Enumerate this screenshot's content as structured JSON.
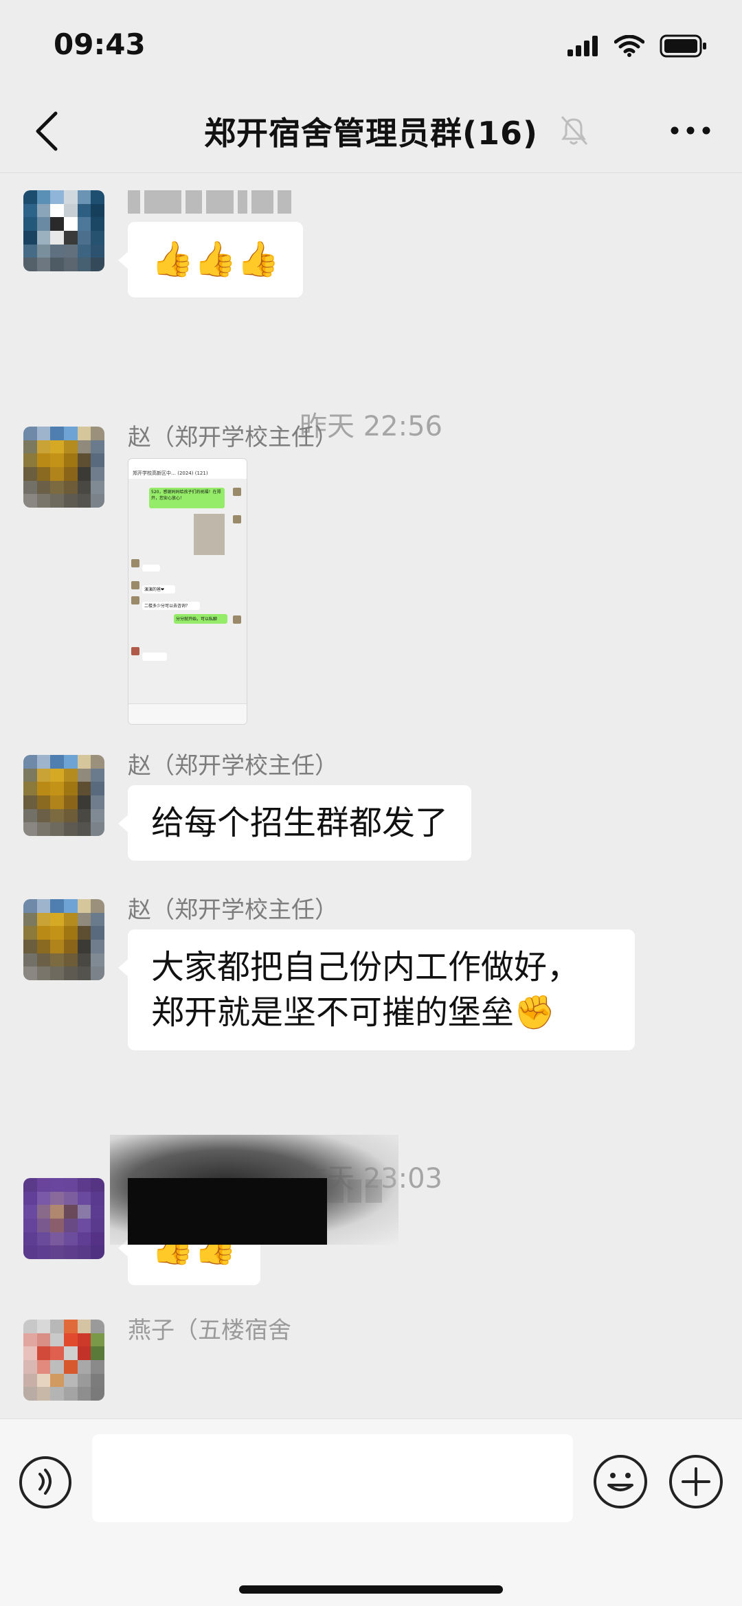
{
  "status_bar": {
    "time": "09:43"
  },
  "nav": {
    "title": "郑开宿舍管理员群(16)"
  },
  "messages": {
    "m1": {
      "content": "👍👍👍"
    },
    "ts1": "昨天 22:56",
    "m2": {
      "sender": "赵（郑开学校主任）",
      "thumb_title": "郑开学校高新区中… (2024) (121)",
      "thumb_text1": "520，感谢妈妈给孩子们的祝福！在郑开，您安心放心！",
      "thumb_text2": "演演的爸❤",
      "thumb_text3": "二楼多少分可以去咨询？",
      "thumb_text4": "分分就开始，可以私聊"
    },
    "m3": {
      "sender": "赵（郑开学校主任）",
      "content": "给每个招生群都发了"
    },
    "m4": {
      "sender": "赵（郑开学校主任）",
      "line1": "大家都把自己份内工作做好，",
      "line2": "郑开就是坚不可摧的堡垒✊"
    },
    "ts2": "昨天 23:03",
    "m5": {
      "content": "👍👍"
    },
    "m6": {
      "sender": "燕子（五楼宿舍"
    }
  },
  "colors": {
    "background": "#ededed",
    "bubble": "#ffffff",
    "wechat_green": "#95ec69",
    "timestamp": "#a5a5a5"
  },
  "icons": [
    "back-chevron",
    "mute-bell",
    "more-dots",
    "voice",
    "emoji",
    "plus"
  ]
}
